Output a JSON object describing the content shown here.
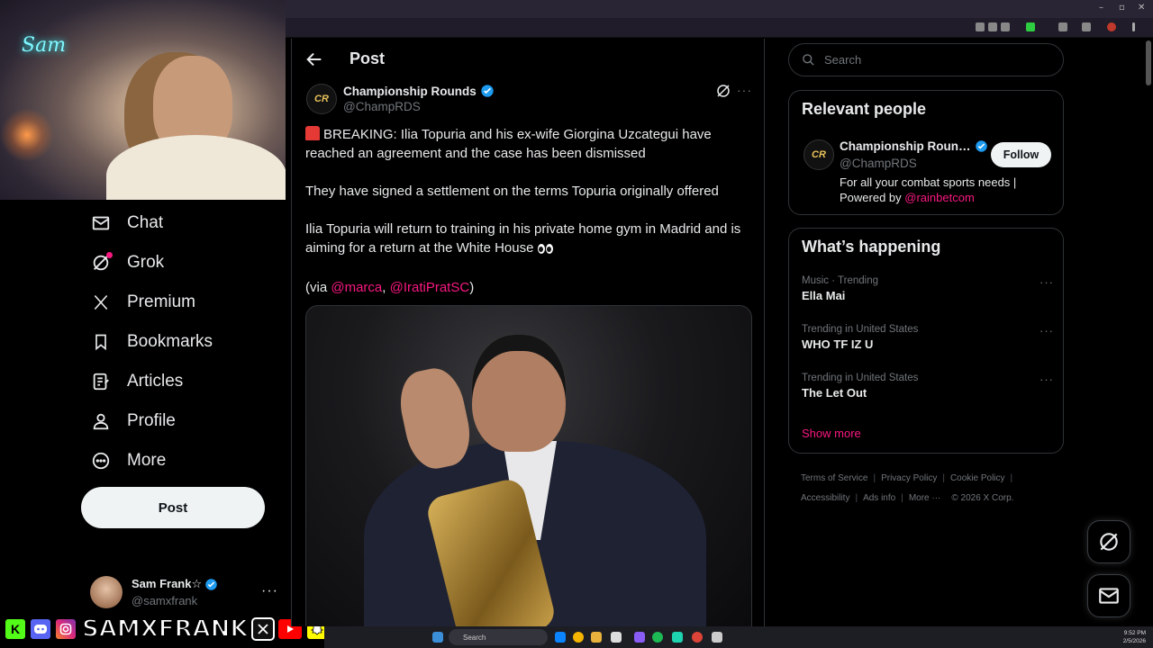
{
  "browser": {
    "window_controls": [
      "–",
      "▫",
      "✕"
    ]
  },
  "overlay": {
    "webcam_sign": "Sam",
    "banner_name": "SAMXFRANK"
  },
  "nav": {
    "items": [
      {
        "label": "Chat",
        "icon": "mail-icon"
      },
      {
        "label": "Grok",
        "icon": "grok-icon"
      },
      {
        "label": "Premium",
        "icon": "x-logo-icon"
      },
      {
        "label": "Bookmarks",
        "icon": "bookmark-icon"
      },
      {
        "label": "Articles",
        "icon": "article-icon"
      },
      {
        "label": "Profile",
        "icon": "person-icon"
      },
      {
        "label": "More",
        "icon": "more-circle-icon"
      }
    ],
    "post_button": "Post",
    "user": {
      "name": "Sam Frank☆",
      "handle": "@samxfrank",
      "more": "···"
    }
  },
  "main": {
    "header_title": "Post",
    "tweet": {
      "author_name": "Championship Rounds",
      "author_handle": "@ChampRDS",
      "avatar_text": "CR",
      "more": "···",
      "line1": "BREAKING: Ilia Topuria and his ex-wife Giorgina Uzcategui have reached an agreement and the case has been dismissed",
      "line2": "They have signed a settlement on the terms Topuria originally offered",
      "line3": "Ilia Topuria will return to training in his private home gym in Madrid and is aiming for a return at the White House",
      "via_prefix": "(via ",
      "mention1": "@marca",
      "comma": ", ",
      "mention2": "@IratiPratSC",
      "via_suffix": ")"
    }
  },
  "right": {
    "search_placeholder": "Search",
    "relevant": {
      "title": "Relevant people",
      "name": "Championship Roun…",
      "handle": "@ChampRDS",
      "avatar_text": "CR",
      "follow": "Follow",
      "bio": "For all your combat sports needs | Powered by ",
      "bio_mention": "@rainbetcom"
    },
    "happening": {
      "title": "What’s happening",
      "trends": [
        {
          "meta": "Music · Trending",
          "name": "Ella Mai"
        },
        {
          "meta": "Trending in United States",
          "name": "WHO TF IZ U"
        },
        {
          "meta": "Trending in United States",
          "name": "The Let Out"
        }
      ],
      "more": "···",
      "show_more": "Show more"
    },
    "footer": {
      "terms": "Terms of Service",
      "privacy": "Privacy Policy",
      "cookie": "Cookie Policy",
      "accessibility": "Accessibility",
      "ads": "Ads info",
      "more": "More ···",
      "copyright": "© 2026 X Corp."
    }
  },
  "taskbar": {
    "search": "Search",
    "time": "9:52 PM",
    "date": "2/5/2026"
  },
  "colors": {
    "accent_pink": "#f91880",
    "verified_blue": "#1d9bf0",
    "text_primary": "#e7e9ea",
    "text_secondary": "#71767b"
  }
}
